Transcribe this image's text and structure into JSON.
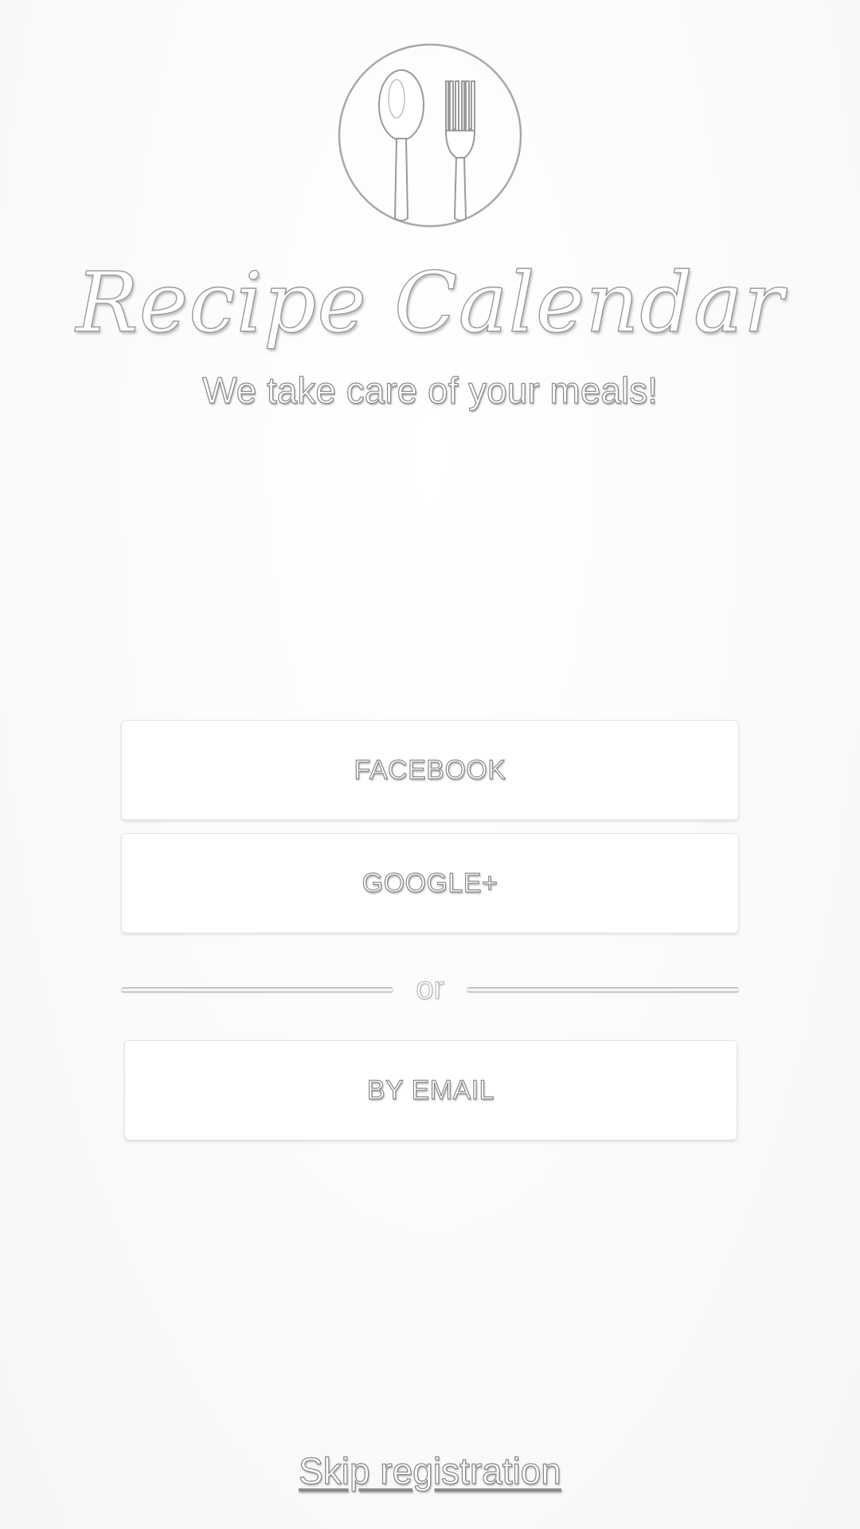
{
  "app": {
    "title": "Recipe Calendar",
    "tagline": "We take care of your meals!",
    "logo_icon": "spoon-fork-plate-icon"
  },
  "auth": {
    "facebook_label": "FACEBOOK",
    "google_label": "GOOGLE+",
    "divider_label": "or",
    "email_label": "BY EMAIL"
  },
  "footer": {
    "skip_label": "Skip registration"
  },
  "colors": {
    "background": "#fbfbfb",
    "button_background": "#ffffff",
    "outline_text": "#8a8a8a"
  }
}
